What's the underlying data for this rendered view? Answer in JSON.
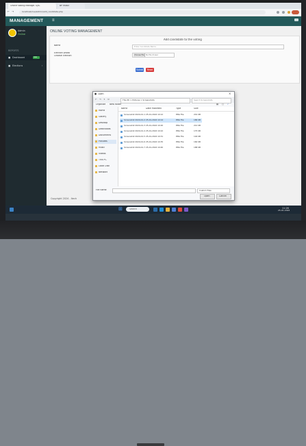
{
  "browser": {
    "tabs": [
      "Online Voting Manage. Sys.",
      "BP Music"
    ],
    "url": "localhost/ovs/admin/add_candidate.php"
  },
  "app": {
    "brand": "MANAGEMENT",
    "menu_icon": "hamburger-icon",
    "user_name": "Admin",
    "user_status": "Online",
    "sidebar": {
      "section_label": "REPORTS",
      "items": [
        {
          "label": "Dashboard",
          "badge": "new"
        },
        {
          "label": "Elections",
          "badge": ""
        }
      ]
    },
    "page_title": "ONLINE VOTING MANAGEMENT",
    "form": {
      "subtitle": "Add candidate to the voting",
      "name_label": "Name",
      "name_placeholder": "Enter Candidate Name",
      "photo_label": "Election photo",
      "photo_label2": "Choose Election",
      "choose_file_label": "Choose File",
      "no_file_label": "No file chosen",
      "submit_label": "Submit",
      "reset_label": "Reset"
    },
    "footer_text": "Copyright 2024 - Itech",
    "accent": "#23595a",
    "sidebar_bg": "#1f2b30"
  },
  "dialog": {
    "title": "Open",
    "path": "This PC > Pictures > Screenshots",
    "search_placeholder": "Search Screenshots",
    "organize_label": "Organize",
    "new_folder_label": "New folder",
    "columns": [
      "Name",
      "Date modified",
      "Type",
      "Size"
    ],
    "tree": [
      "Home",
      "Gallery",
      "Desktop",
      "Downloads",
      "Documents",
      "Pictures",
      "Music",
      "Videos",
      "This PC",
      "Local Disk",
      "Network"
    ],
    "files": [
      {
        "name": "Screenshot 2024-01-1",
        "date": "25-01-2024 10:12",
        "type": "PNG File",
        "size": "201 KB",
        "selected": false
      },
      {
        "name": "Screenshot 2024-01-2",
        "date": "25-01-2024 10:14",
        "type": "PNG File",
        "size": "186 KB",
        "selected": true
      },
      {
        "name": "Screenshot 2024-01-3",
        "date": "25-01-2024 10:20",
        "type": "PNG File",
        "size": "212 KB",
        "selected": false
      },
      {
        "name": "Screenshot 2024-01-4",
        "date": "25-01-2024 10:22",
        "type": "PNG File",
        "size": "175 KB",
        "selected": false
      },
      {
        "name": "Screenshot 2024-01-5",
        "date": "25-01-2024 10:31",
        "type": "PNG File",
        "size": "194 KB",
        "selected": false
      },
      {
        "name": "Screenshot 2024-01-6",
        "date": "25-01-2024 10:35",
        "type": "PNG File",
        "size": "160 KB",
        "selected": false
      },
      {
        "name": "Screenshot 2024-01-7",
        "date": "25-01-2024 10:40",
        "type": "PNG File",
        "size": "188 KB",
        "selected": false
      }
    ],
    "filename_label": "File name:",
    "filetype_label": "Custom Files",
    "open_label": "Open",
    "cancel_label": "Cancel"
  },
  "taskbar": {
    "search_placeholder": "Search",
    "time": "11:26",
    "date": "25-01-2024",
    "icons": [
      "windows-icon",
      "search-icon",
      "task-view-icon",
      "edge-icon",
      "explorer-icon",
      "store-icon",
      "chrome-icon"
    ]
  }
}
